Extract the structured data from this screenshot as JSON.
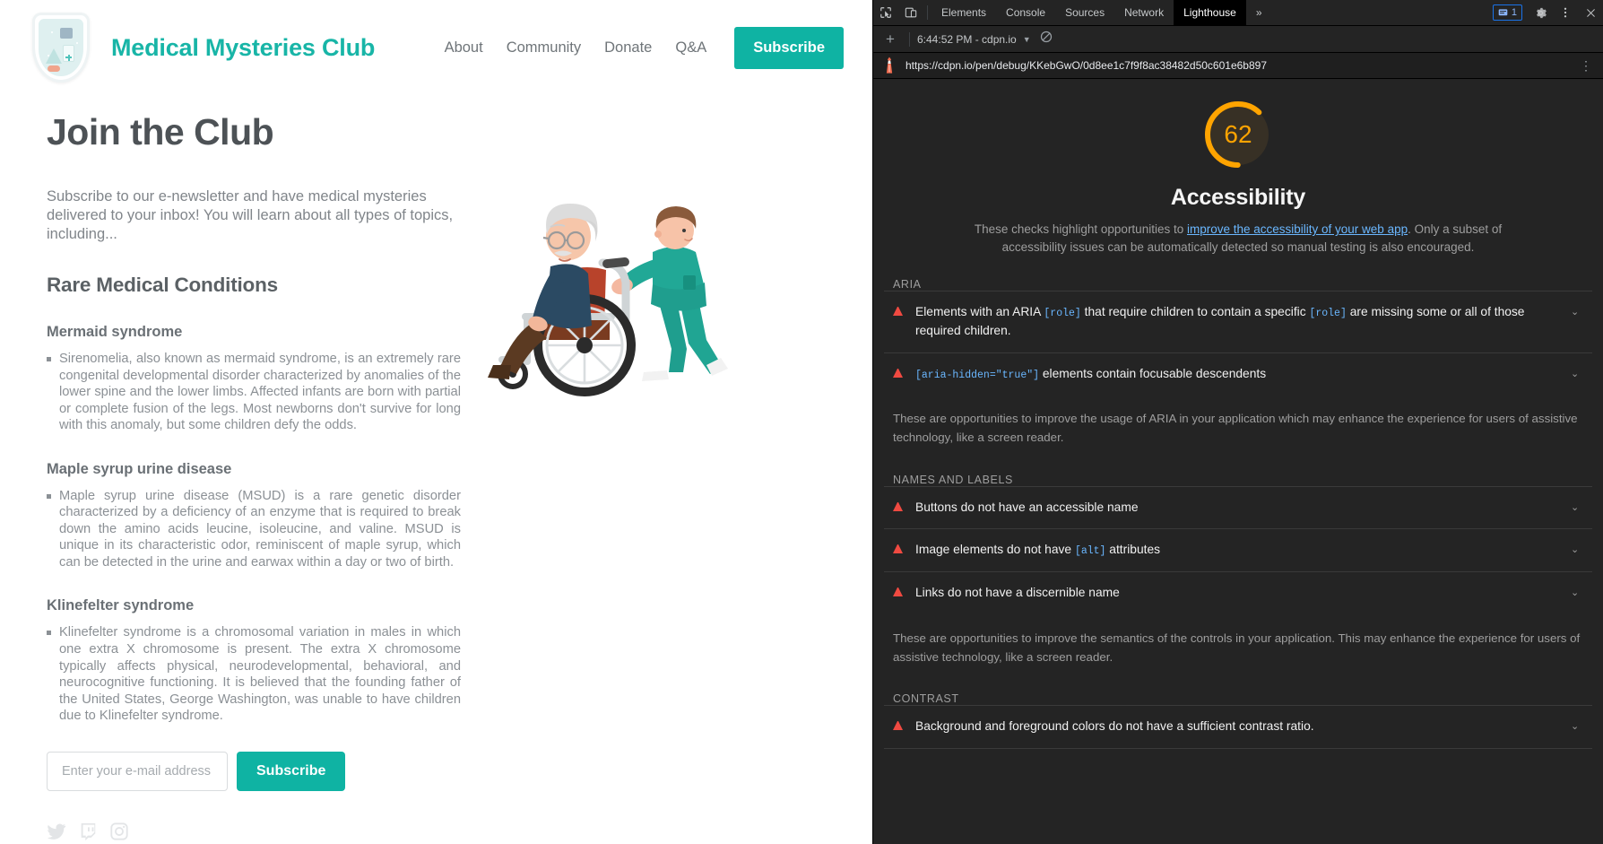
{
  "site": {
    "brand": "Medical Mysteries Club",
    "nav": [
      {
        "label": "About"
      },
      {
        "label": "Community"
      },
      {
        "label": "Donate"
      },
      {
        "label": "Q&A"
      }
    ],
    "subscribe_top": "Subscribe",
    "title": "Join the Club",
    "intro": "Subscribe to our e-newsletter and have medical mysteries delivered to your inbox! You will learn about all types of topics, including...",
    "section_title": "Rare Medical Conditions",
    "conditions": [
      {
        "name": "Mermaid syndrome",
        "body": "Sirenomelia, also known as mermaid syndrome, is an extremely rare congenital developmental disorder characterized by anomalies of the lower spine and the lower limbs. Affected infants are born with partial or complete fusion of the legs. Most newborns don't survive for long with this anomaly, but some children defy the odds."
      },
      {
        "name": "Maple syrup urine disease",
        "body": "Maple syrup urine disease (MSUD) is a rare genetic disorder characterized by a deficiency of an enzyme that is required to break down the amino acids leucine, isoleucine, and valine. MSUD is unique in its characteristic odor, reminiscent of maple syrup, which can be detected in the urine and earwax within a day or two of birth."
      },
      {
        "name": "Klinefelter syndrome",
        "body": "Klinefelter syndrome is a chromosomal variation in males in which one extra X chromosome is present. The extra X chromosome typically affects physical, neurodevelopmental, behavioral, and neurocognitive functioning. It is believed that the founding father of the United States, George Washington, was unable to have children due to Klinefelter syndrome."
      }
    ],
    "form": {
      "placeholder": "Enter your e-mail address",
      "button": "Subscribe"
    },
    "socials": [
      {
        "name": "twitter"
      },
      {
        "name": "twitch"
      },
      {
        "name": "instagram"
      }
    ],
    "colors": {
      "accent": "#0fb3a3",
      "brand": "#18b5a7",
      "heading": "#4d5256",
      "body": "#8b9095"
    }
  },
  "devtools": {
    "tabs": [
      {
        "label": "Elements",
        "active": false
      },
      {
        "label": "Console",
        "active": false
      },
      {
        "label": "Sources",
        "active": false
      },
      {
        "label": "Network",
        "active": false
      },
      {
        "label": "Lighthouse",
        "active": true
      }
    ],
    "overflow": "»",
    "issues_count": "1",
    "run_label": "6:44:52 PM - cdpn.io",
    "url": "https://cdpn.io/pen/debug/KKebGwO/0d8ee1c7f9f8ac38482d50c601e6b897",
    "icons": {
      "inspect": "inspect-icon",
      "device": "device-toolbar-icon",
      "settings": "gear-icon",
      "more": "more-vertical-icon",
      "close": "close-icon",
      "issues": "issues-icon",
      "add_report": "plus-icon",
      "clear": "no-entry-icon"
    }
  },
  "lighthouse": {
    "score": "62",
    "score_value": 62,
    "score_color": "#ffa400",
    "category": "Accessibility",
    "description_parts": {
      "p1": "These checks highlight opportunities to ",
      "link": "improve the accessibility of your web app",
      "p2": ". Only a subset of accessibility issues can be automatically detected so manual testing is also encouraged."
    },
    "groups": [
      {
        "title": "ARIA",
        "audits": [
          {
            "parts": [
              {
                "type": "text",
                "value": "Elements with an ARIA "
              },
              {
                "type": "code",
                "value": "[role]"
              },
              {
                "type": "text",
                "value": " that require children to contain a specific "
              },
              {
                "type": "code",
                "value": "[role]"
              },
              {
                "type": "text",
                "value": " are missing some or all of those required children."
              }
            ]
          },
          {
            "parts": [
              {
                "type": "code",
                "value": "[aria-hidden=\"true\"]"
              },
              {
                "type": "text",
                "value": " elements contain focusable descendents"
              }
            ]
          }
        ],
        "description": "These are opportunities to improve the usage of ARIA in your application which may enhance the experience for users of assistive technology, like a screen reader."
      },
      {
        "title": "NAMES AND LABELS",
        "audits": [
          {
            "parts": [
              {
                "type": "text",
                "value": "Buttons do not have an accessible name"
              }
            ]
          },
          {
            "parts": [
              {
                "type": "text",
                "value": "Image elements do not have "
              },
              {
                "type": "code",
                "value": "[alt]"
              },
              {
                "type": "text",
                "value": " attributes"
              }
            ]
          },
          {
            "parts": [
              {
                "type": "text",
                "value": "Links do not have a discernible name"
              }
            ]
          }
        ],
        "description": "These are opportunities to improve the semantics of the controls in your application. This may enhance the experience for users of assistive technology, like a screen reader."
      },
      {
        "title": "CONTRAST",
        "audits": [
          {
            "parts": [
              {
                "type": "text",
                "value": "Background and foreground colors do not have a sufficient contrast ratio."
              }
            ]
          }
        ],
        "description": ""
      }
    ]
  }
}
